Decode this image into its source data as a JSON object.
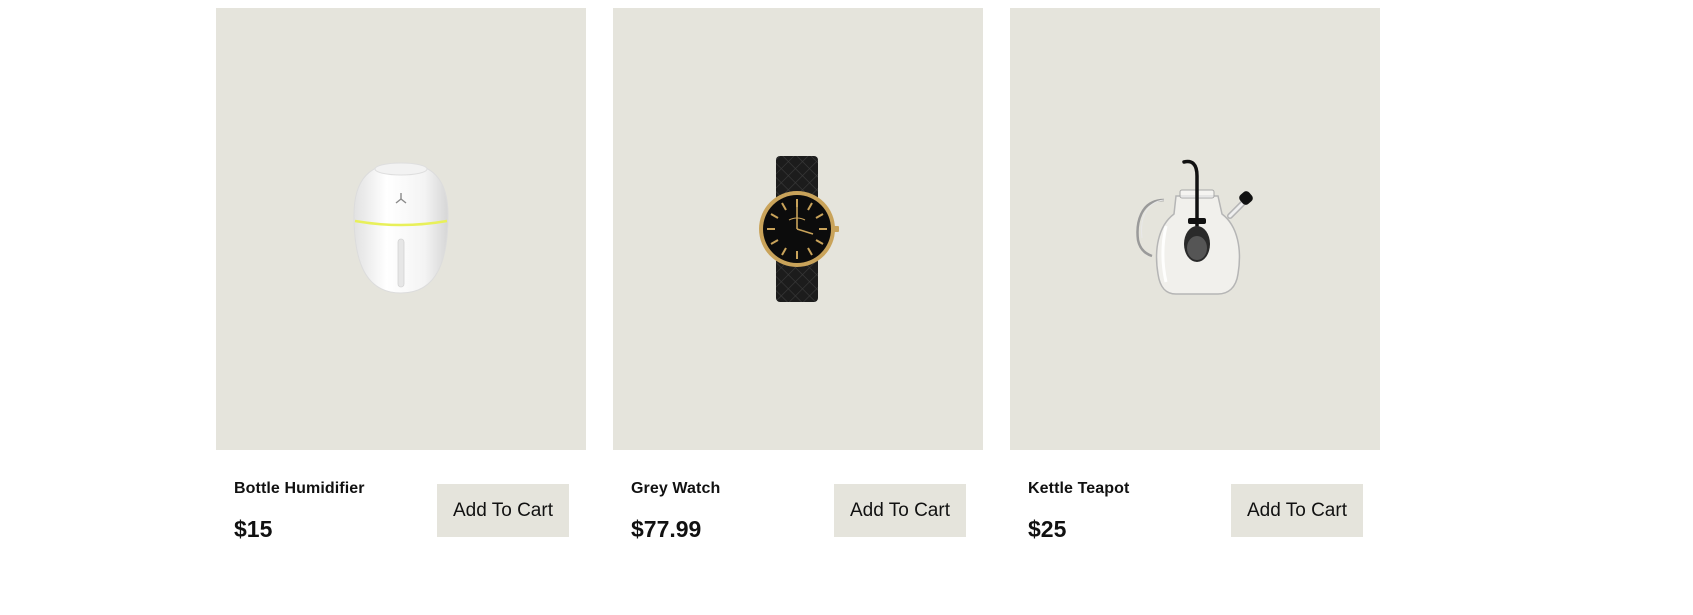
{
  "products": [
    {
      "name": "Bottle Humidifier",
      "price": "$15",
      "cart_label": "Add To Cart",
      "image_icon": "humidifier-icon"
    },
    {
      "name": "Grey Watch",
      "price": "$77.99",
      "cart_label": "Add To Cart",
      "image_icon": "watch-icon"
    },
    {
      "name": "Kettle Teapot",
      "price": "$25",
      "cart_label": "Add To Cart",
      "image_icon": "teapot-icon"
    }
  ],
  "colors": {
    "card_bg": "#e5e4dc",
    "text": "#111111",
    "page_bg": "#ffffff"
  }
}
